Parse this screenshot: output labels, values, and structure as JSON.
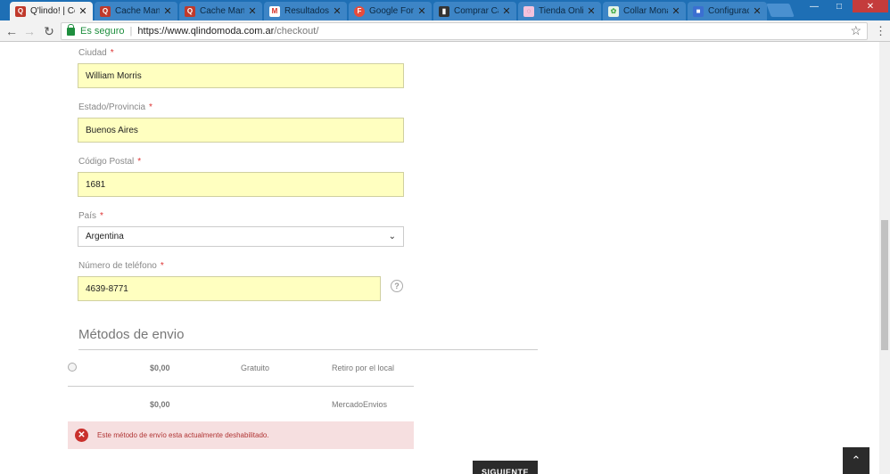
{
  "browser": {
    "tabs": [
      {
        "title": "Q'lindo! | Co",
        "icon": "qlindo-icon",
        "color": "#c0392b",
        "glyph": "Q",
        "active": true
      },
      {
        "title": "Cache Mana",
        "icon": "qlindo-icon",
        "color": "#c0392b",
        "glyph": "Q"
      },
      {
        "title": "Cache Mana",
        "icon": "qlindo-icon",
        "color": "#c0392b",
        "glyph": "Q"
      },
      {
        "title": "Resultados d",
        "icon": "gmail-icon",
        "color": "#d93025",
        "glyph": "M"
      },
      {
        "title": "Google Font",
        "icon": "google-fonts-icon",
        "color": "#e74c3c",
        "glyph": "F"
      },
      {
        "title": "Comprar Ca",
        "icon": "chart-icon",
        "color": "#333333",
        "glyph": "▮"
      },
      {
        "title": "Tienda Onli",
        "icon": "shop-icon",
        "color": "#d98ab5",
        "glyph": "◌"
      },
      {
        "title": "Collar Mona",
        "icon": "leaf-icon",
        "color": "#4caf50",
        "glyph": "✿"
      },
      {
        "title": "Configuracio",
        "icon": "settings-page-icon",
        "color": "#3b6fd1",
        "glyph": "■"
      }
    ],
    "address": {
      "secure_label": "Es seguro",
      "host": "https://www.qlindomoda.com.ar",
      "path": "/checkout/"
    }
  },
  "form": {
    "city": {
      "label": "Ciudad",
      "value": "William Morris"
    },
    "state": {
      "label": "Estado/Provincia",
      "value": "Buenos Aires"
    },
    "postal": {
      "label": "Código Postal",
      "value": "1681"
    },
    "country": {
      "label": "País",
      "value": "Argentina"
    },
    "phone": {
      "label": "Número de teléfono",
      "value": "4639-8771"
    },
    "required_mark": "*"
  },
  "shipping": {
    "title": "Métodos de envio",
    "methods": [
      {
        "price": "$0,00",
        "desc": "Gratuito",
        "name": "Retiro por el local"
      },
      {
        "price": "$0,00",
        "desc": "",
        "name": "MercadoEnvios"
      }
    ],
    "alert": "Este método de envío esta actualmente deshabilitado."
  },
  "actions": {
    "next_label": "SIGUIENTE"
  }
}
